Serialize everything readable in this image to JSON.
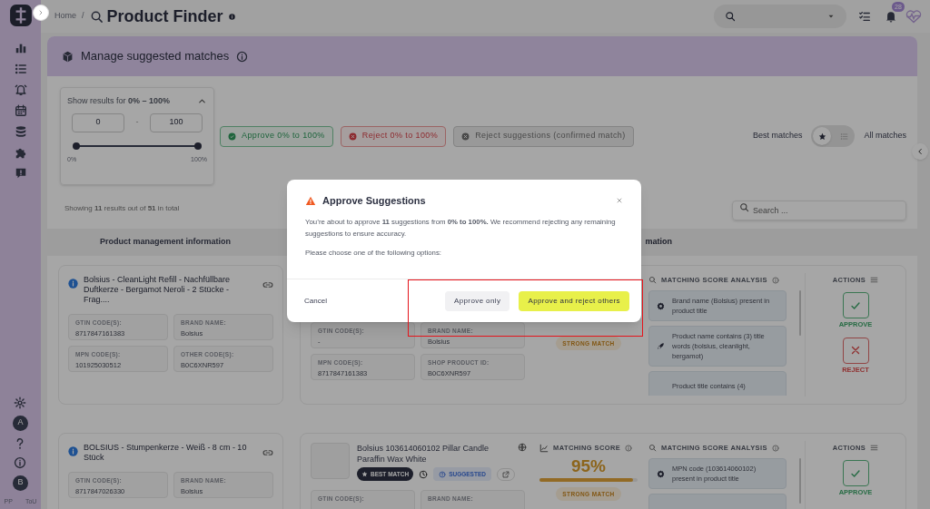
{
  "sidebar": {
    "avatars": [
      "A",
      "B"
    ],
    "footer_links": [
      "PP",
      "ToU"
    ]
  },
  "breadcrumb": {
    "home": "Home",
    "separator": "/",
    "title": "Product Finder"
  },
  "topbar": {
    "notification_count": "28"
  },
  "panel": {
    "title": "Manage suggested matches"
  },
  "filter": {
    "label": "Show results for **0% – 100%**",
    "expanded": true,
    "min_value": "0",
    "separator": "-",
    "max_value": "100",
    "slider": {
      "level": 1
    },
    "min_label": "0%",
    "max_label": "100%"
  },
  "bulk_actions": [
    {
      "kind": "approve",
      "label": "Approve 0% to 100%",
      "disabled": false
    },
    {
      "kind": "reject",
      "label": "Reject 0% to 100%",
      "disabled": false
    },
    {
      "kind": "reject",
      "label": "Reject suggestions (confirmed match)",
      "disabled": true
    }
  ],
  "view_toggle": [
    {
      "label": "Best matches",
      "selected": true
    },
    {
      "label": "All matches",
      "selected": false
    }
  ],
  "results_summary": "Showing **11** results out of **51** in total",
  "search": {
    "placeholder": "Search ..."
  },
  "table": {
    "columns": [
      "Product management information",
      "mation"
    ],
    "rows": [
      {
        "product": {
          "title": "Bolsius - CleanLight Refill - Nachfüllbare Duftkerze - Bergamot Neroli - 2 Stücke - Frag....",
          "fields": [
            {
              "label": "GTIN CODE(S):",
              "value": "8717847161383"
            },
            {
              "label": "BRAND NAME:",
              "value": "Bolsius"
            },
            {
              "label": "MPN CODE(S):",
              "value": "101925030512"
            },
            {
              "label": "OTHER CODE(S):",
              "value": "B0C6XNR597"
            }
          ]
        },
        "match": {
          "fields": [
            {
              "label": "GTIN CODE(S):",
              "value": "-"
            },
            {
              "label": "BRAND NAME:",
              "value": "Bolsius"
            },
            {
              "label": "MPN CODE(S):",
              "value": "8717847161383"
            },
            {
              "label": "SHOP PRODUCT ID:",
              "value": "B0C6XNR597"
            }
          ],
          "match_label": "STRONG MATCH"
        },
        "analysis_title": "MATCHING SCORE ANALYSIS",
        "analysis": [
          {
            "kind": "brand",
            "text": "Brand name (Bolsius) present in product title"
          },
          {
            "kind": "words",
            "text": "Product name contains (3) title words (bolsius, cleanlight, bergamot)"
          },
          {
            "kind": "title",
            "text": "Product title contains (4)"
          }
        ],
        "actions_title": "ACTIONS",
        "actions": [
          {
            "kind": "approve",
            "label": "APPROVE"
          },
          {
            "kind": "reject",
            "label": "REJECT"
          }
        ]
      },
      {
        "product": {
          "title": "BOLSIUS - Stumpenkerze - Weiß - 8 cm - 10 Stück",
          "fields": [
            {
              "label": "GTIN CODE(S):",
              "value": "8717847026330"
            },
            {
              "label": "BRAND NAME:",
              "value": "Bolsius"
            }
          ]
        },
        "match": {
          "title": "Bolsius 103614060102 Pillar Candle Paraffin Wax White",
          "best_label": "BEST MATCH",
          "status_label": "SUGGESTED",
          "score_title": "MATCHING SCORE",
          "score": "95%",
          "level": 0.95,
          "fields": [
            {
              "label": "GTIN CODE(S):"
            },
            {
              "label": "BRAND NAME:"
            }
          ],
          "match_label": "STRONG MATCH"
        },
        "analysis_title": "MATCHING SCORE ANALYSIS",
        "analysis": [
          {
            "kind": "brand",
            "text": "MPN code (103614060102) present in product title"
          },
          {
            "kind": "title"
          }
        ],
        "actions_title": "ACTIONS",
        "actions": [
          {
            "kind": "approve",
            "label": "APPROVE"
          }
        ]
      }
    ]
  },
  "modal": {
    "title": "Approve Suggestions",
    "message": "You’re about to approve **11** suggestions from **0% to 100%.** We recommend rejecting any remaining suggestions to ensure accuracy.",
    "prompt": "Please choose one of the following options:",
    "buttons": [
      {
        "kind": "cancel",
        "label": "Cancel"
      },
      {
        "kind": "secondary",
        "label": "Approve only"
      },
      {
        "kind": "primary",
        "label": "Approve and reject others"
      }
    ]
  }
}
